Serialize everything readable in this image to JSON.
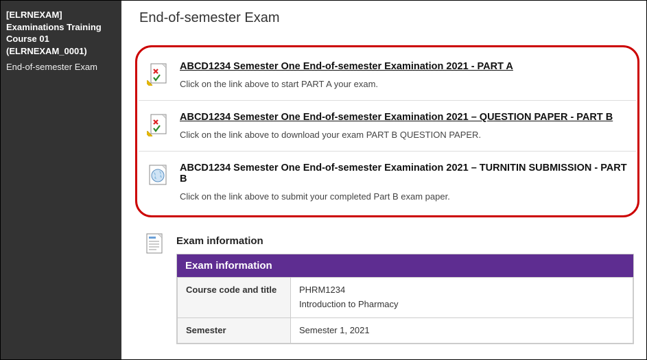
{
  "sidebar": {
    "course_title": "[ELRNEXAM] Examinations Training Course 01 (ELRNEXAM_0001)",
    "breadcrumb": "End-of-semester Exam"
  },
  "page": {
    "title": "End-of-semester Exam"
  },
  "items": [
    {
      "title": "ABCD1234 Semester One End-of-semester Examination 2021 - PART A",
      "desc": "Click on the link above to start PART A your exam.",
      "icon": "test",
      "linked": true
    },
    {
      "title": "ABCD1234 Semester One End-of-semester Examination 2021 – QUESTION PAPER - PART B",
      "desc": "Click on the link above to download your exam PART B QUESTION PAPER.",
      "icon": "test",
      "linked": true
    },
    {
      "title": "ABCD1234 Semester One End-of-semester Examination 2021 – TURNITIN SUBMISSION - PART B",
      "desc": "Click on the link above to submit your completed Part B exam paper.",
      "icon": "globe",
      "linked": false
    }
  ],
  "info": {
    "heading": "Exam information",
    "table_title": "Exam information",
    "rows": [
      {
        "label": "Course code and title",
        "value": "PHRM1234\nIntroduction to Pharmacy"
      },
      {
        "label": "Semester",
        "value": "Semester 1, 2021"
      }
    ]
  }
}
